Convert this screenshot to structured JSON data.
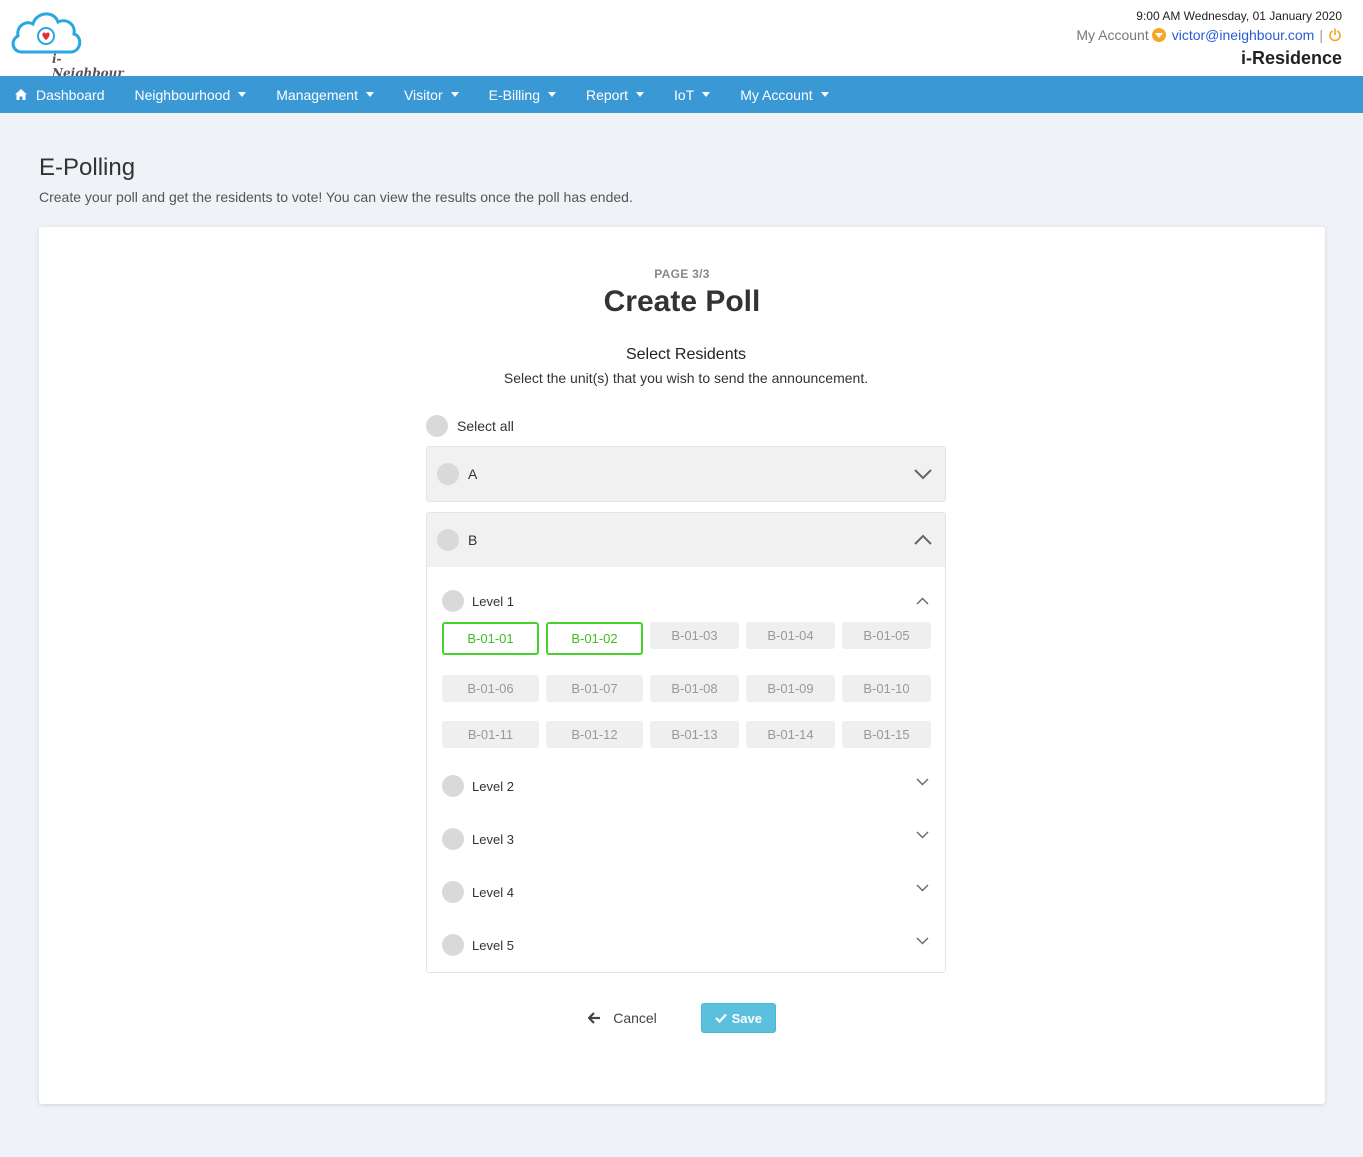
{
  "header": {
    "logo_text": "i-Neighbour",
    "datetime": "9:00 AM Wednesday, 01 January 2020",
    "account_label": "My Account",
    "email": "victor@ineighbour.com",
    "separator": "|",
    "site_name": "i-Residence"
  },
  "nav": {
    "items": [
      {
        "label": "Dashboard"
      },
      {
        "label": "Neighbourhood"
      },
      {
        "label": "Management"
      },
      {
        "label": "Visitor"
      },
      {
        "label": "E-Billing"
      },
      {
        "label": "Report"
      },
      {
        "label": "IoT"
      },
      {
        "label": "My Account"
      }
    ]
  },
  "page": {
    "title": "E-Polling",
    "subtitle": "Create your poll and get the residents to vote! You can view the results once the poll has ended."
  },
  "form": {
    "page_indicator": "PAGE 3/3",
    "title": "Create Poll",
    "section_title": "Select Residents",
    "section_desc": "Select the unit(s) that you wish to send the announcement.",
    "select_all": "Select all",
    "blocks": [
      {
        "label": "A",
        "expanded": false
      },
      {
        "label": "B",
        "expanded": true,
        "levels": [
          {
            "label": "Level 1",
            "expanded": true,
            "units": [
              {
                "label": "B-01-01",
                "selected": true
              },
              {
                "label": "B-01-02",
                "selected": true
              },
              {
                "label": "B-01-03",
                "selected": false
              },
              {
                "label": "B-01-04",
                "selected": false
              },
              {
                "label": "B-01-05",
                "selected": false
              },
              {
                "label": "B-01-06",
                "selected": false
              },
              {
                "label": "B-01-07",
                "selected": false
              },
              {
                "label": "B-01-08",
                "selected": false
              },
              {
                "label": "B-01-09",
                "selected": false
              },
              {
                "label": "B-01-10",
                "selected": false
              },
              {
                "label": "B-01-11",
                "selected": false
              },
              {
                "label": "B-01-12",
                "selected": false
              },
              {
                "label": "B-01-13",
                "selected": false
              },
              {
                "label": "B-01-14",
                "selected": false
              },
              {
                "label": "B-01-15",
                "selected": false
              }
            ]
          },
          {
            "label": "Level 2",
            "expanded": false
          },
          {
            "label": "Level 3",
            "expanded": false
          },
          {
            "label": "Level 4",
            "expanded": false
          },
          {
            "label": "Level 5",
            "expanded": false
          }
        ]
      }
    ],
    "cancel_label": "Cancel",
    "save_label": "Save"
  },
  "colors": {
    "nav_bg": "#3a99d5",
    "selected_unit": "#47d12a",
    "save_button": "#5bc0de",
    "account_dropdown": "#f5a623"
  },
  "icons": [
    "home-icon",
    "chevron-down-icon",
    "chevron-up-icon",
    "arrow-left-icon",
    "check-icon",
    "power-icon",
    "caret-down-icon"
  ]
}
